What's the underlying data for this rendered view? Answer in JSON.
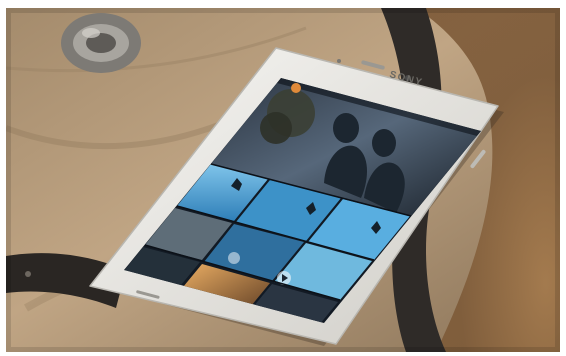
{
  "photo": {
    "subject": "smartphone",
    "brand_text": "SONY",
    "colors": {
      "canvas_bag": "#b59a78",
      "strap": "#2f2b28",
      "buckle": "#8d8a85",
      "sand": "#9a6f45",
      "phone_body": "#ecebe7",
      "screen_dark": "#121a24",
      "sky_blue": "#4ba3d6",
      "sunset_orange": "#d98a3a"
    }
  }
}
